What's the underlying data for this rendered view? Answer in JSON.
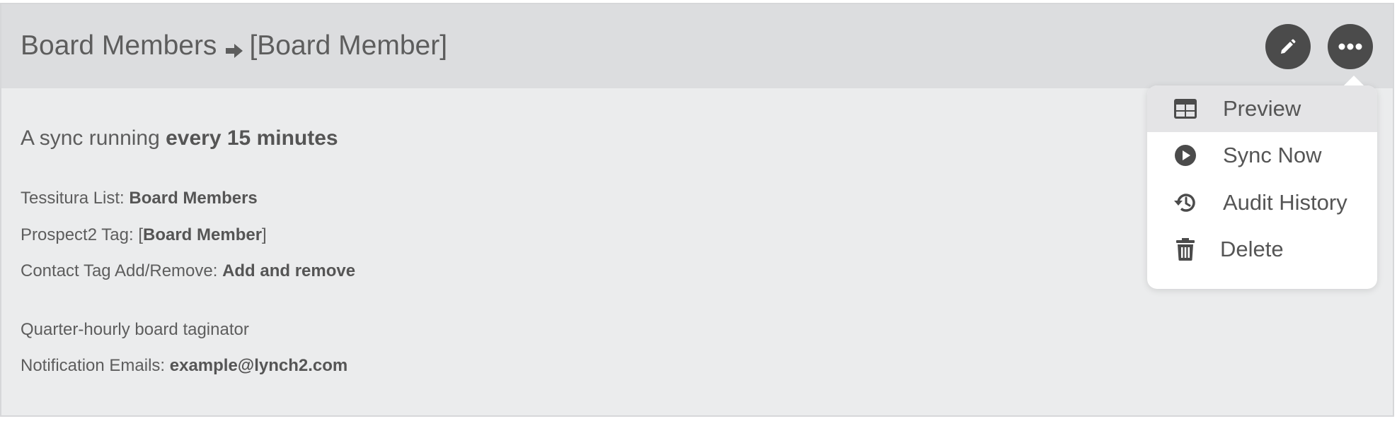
{
  "header": {
    "title_source": "Board Members",
    "title_target": "[Board Member]"
  },
  "body": {
    "summary_prefix": "A sync running ",
    "summary_frequency": "every 15 minutes",
    "fields": [
      {
        "label": "Tessitura List: ",
        "value": "Board Members"
      },
      {
        "label": "Prospect2 Tag: ",
        "value_prefix": "[",
        "value": "Board Member",
        "value_suffix": "]"
      },
      {
        "label": "Contact Tag Add/Remove: ",
        "value": "Add and remove"
      }
    ],
    "description": "Quarter-hourly board taginator",
    "notification_label": "Notification Emails: ",
    "notification_value": "example@lynch2.com"
  },
  "menu": {
    "items": [
      {
        "label": "Preview",
        "icon": "table-icon",
        "active": true
      },
      {
        "label": "Sync Now",
        "icon": "play-circle-icon",
        "active": false
      },
      {
        "label": "Audit History",
        "icon": "history-icon",
        "active": false
      },
      {
        "label": "Delete",
        "icon": "trash-icon",
        "active": false
      }
    ]
  },
  "colors": {
    "header_bg": "#dcdddf",
    "card_bg": "#ebeced",
    "button_bg": "#4b4b4b",
    "text": "#5d5d5d",
    "menu_active_bg": "#e4e4e6"
  }
}
